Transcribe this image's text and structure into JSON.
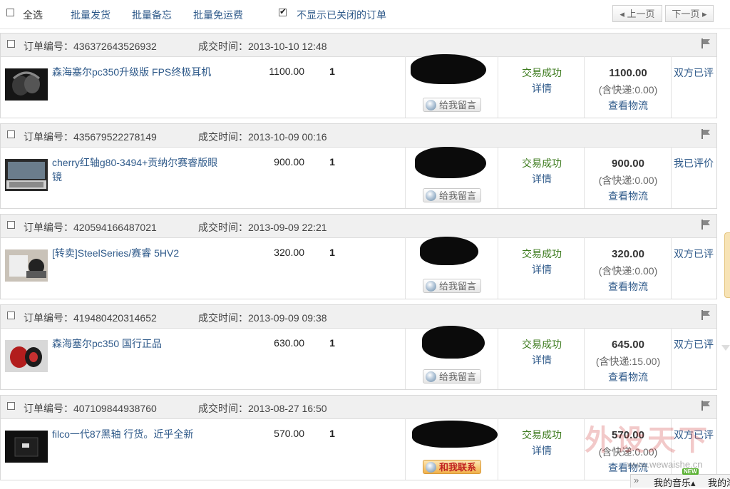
{
  "toolbar": {
    "select_all": "全选",
    "batch_ship": "批量发货",
    "batch_note": "批量备忘",
    "batch_free_shipping": "批量免运费",
    "hide_closed_label": "不显示已关闭的订单",
    "hide_closed_checked": true,
    "prev_page": "◂ 上一页",
    "next_page": "下一页 ▸"
  },
  "labels": {
    "order_no_prefix": "订单编号：",
    "deal_time_prefix": "成交时间：",
    "status_detail": "详情",
    "view_logistics": "查看物流"
  },
  "orders": [
    {
      "order_no": "436372643526932",
      "deal_time": "2013-10-10 12:48",
      "title": "森海塞尔pc350升级版 FPS终极耳机",
      "price": "1100.00",
      "qty": "1",
      "message_btn": "给我留言",
      "status": "交易成功",
      "total": "1100.00",
      "shipping": "(含快递:0.00)",
      "review": "双方已评",
      "thumb_icon": "headphones-thumbnail"
    },
    {
      "order_no": "435679522278149",
      "deal_time": "2013-10-09 00:16",
      "title": "cherry红轴g80-3494+贡纳尔赛睿版眼镜",
      "price": "900.00",
      "qty": "1",
      "message_btn": "给我留言",
      "status": "交易成功",
      "total": "900.00",
      "shipping": "(含快递:0.00)",
      "review": "我已评价",
      "thumb_icon": "keyboard-thumbnail"
    },
    {
      "order_no": "420594166487021",
      "deal_time": "2013-09-09 22:21",
      "title": "[转卖]SteelSeries/赛睿 5HV2",
      "price": "320.00",
      "qty": "1",
      "message_btn": "给我留言",
      "status": "交易成功",
      "total": "320.00",
      "shipping": "(含快递:0.00)",
      "review": "双方已评",
      "thumb_icon": "headset-box-thumbnail"
    },
    {
      "order_no": "419480420314652",
      "deal_time": "2013-09-09 09:38",
      "title": "森海塞尔pc350 国行正品",
      "price": "630.00",
      "qty": "1",
      "message_btn": "给我留言",
      "status": "交易成功",
      "total": "645.00",
      "shipping": "(含快递:15.00)",
      "review": "双方已评",
      "thumb_icon": "red-headphones-thumbnail"
    },
    {
      "order_no": "407109844938760",
      "deal_time": "2013-08-27 16:50",
      "title": "filco一代87黑轴 行货。近乎全新",
      "price": "570.00",
      "qty": "1",
      "message_btn": "和我联系",
      "status": "交易成功",
      "total": "570.00",
      "shipping": "(含快递:0.00)",
      "review": "双方已评",
      "thumb_icon": "keyboard-box-thumbnail"
    }
  ],
  "watermark": {
    "text": "外设天下",
    "url": "www.wewaishe.cn"
  },
  "bottom_bar": {
    "music": "我的音乐",
    "badge": "NEW",
    "mine": "我的淘"
  }
}
